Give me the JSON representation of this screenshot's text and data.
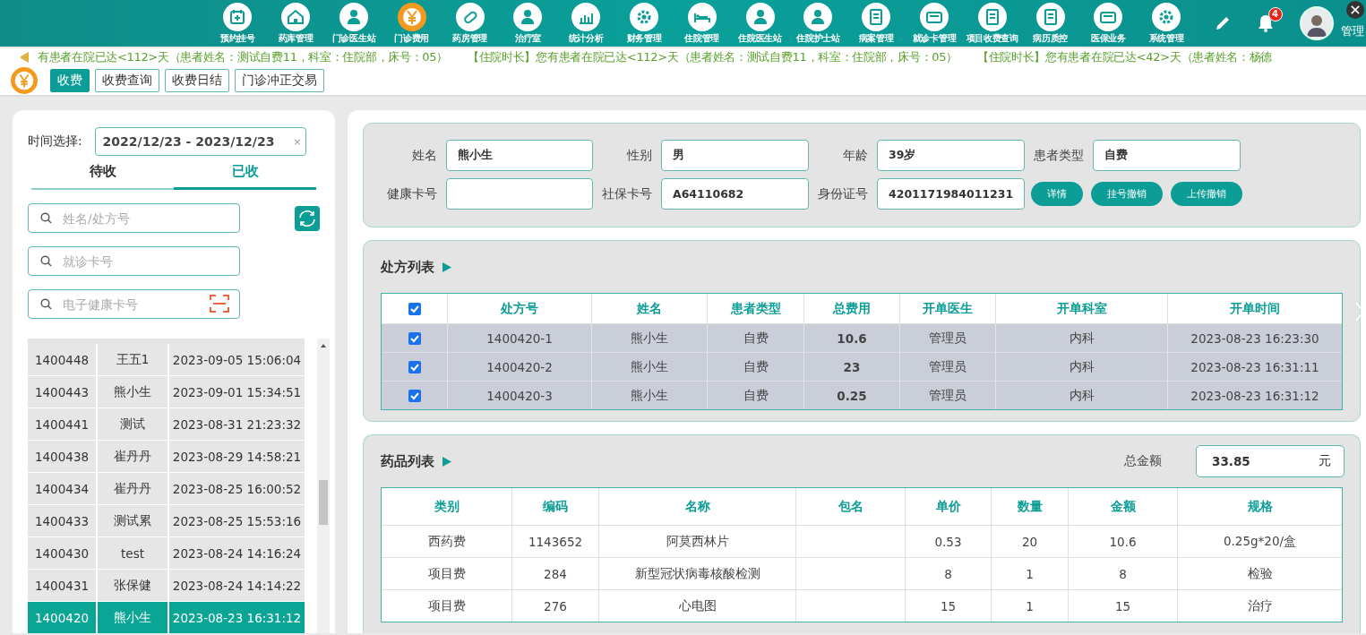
{
  "nav": {
    "items": [
      {
        "label": "预约挂号",
        "selected": false
      },
      {
        "label": "药库管理",
        "selected": false
      },
      {
        "label": "门诊医生站",
        "selected": false
      },
      {
        "label": "门诊费用",
        "selected": true
      },
      {
        "label": "药房管理",
        "selected": false
      },
      {
        "label": "治疗室",
        "selected": false
      },
      {
        "label": "统计分析",
        "selected": false
      },
      {
        "label": "财务管理",
        "selected": false
      },
      {
        "label": "住院管理",
        "selected": false
      },
      {
        "label": "住院医生站",
        "selected": false
      },
      {
        "label": "住院护士站",
        "selected": false
      },
      {
        "label": "病案管理",
        "selected": false
      },
      {
        "label": "就诊卡管理",
        "selected": false
      },
      {
        "label": "项目收费查询",
        "selected": false
      },
      {
        "label": "病历质控",
        "selected": false
      },
      {
        "label": "医保业务",
        "selected": false
      },
      {
        "label": "系统管理",
        "selected": false
      }
    ],
    "notification_count": "4",
    "user_name": "管理"
  },
  "notices": [
    "有患者在院已达<112>天（患者姓名：测试自费11，科室：住院部，床号：05）",
    "【住院时长】您有患者在院已达<112>天（患者姓名：测试自费11，科室：住院部，床号：05）",
    "【住院时长】您有患者在院已达<42>天（患者姓名：杨德"
  ],
  "sub_tabs": [
    {
      "label": "收费",
      "selected": true
    },
    {
      "label": "收费查询",
      "selected": false
    },
    {
      "label": "收费日结",
      "selected": false
    },
    {
      "label": "门诊冲正交易",
      "selected": false
    }
  ],
  "filter": {
    "label": "时间选择:",
    "date_range": "2022/12/23 - 2023/12/23",
    "clear": "×"
  },
  "status_tabs": [
    {
      "label": "待收",
      "selected": false
    },
    {
      "label": "已收",
      "selected": true
    }
  ],
  "search_fields": [
    {
      "placeholder": "姓名/处方号",
      "kind": "text"
    },
    {
      "placeholder": "就诊卡号",
      "kind": "text"
    },
    {
      "placeholder": "电子健康卡号",
      "kind": "scan"
    }
  ],
  "records": [
    {
      "id": "1400448",
      "name": "王五1",
      "time": "2023-09-05 15:06:04",
      "selected": false
    },
    {
      "id": "1400443",
      "name": "熊小生",
      "time": "2023-09-01 15:34:51",
      "selected": false
    },
    {
      "id": "1400441",
      "name": "测试",
      "time": "2023-08-31 21:23:32",
      "selected": false
    },
    {
      "id": "1400438",
      "name": "崔丹丹",
      "time": "2023-08-29 14:58:21",
      "selected": false
    },
    {
      "id": "1400434",
      "name": "崔丹丹",
      "time": "2023-08-25 16:00:52",
      "selected": false
    },
    {
      "id": "1400433",
      "name": "测试累",
      "time": "2023-08-25 15:53:16",
      "selected": false
    },
    {
      "id": "1400430",
      "name": "test",
      "time": "2023-08-24 14:16:24",
      "selected": false
    },
    {
      "id": "1400431",
      "name": "张保健",
      "time": "2023-08-24 14:14:22",
      "selected": false
    },
    {
      "id": "1400420",
      "name": "熊小生",
      "time": "2023-08-23 16:31:12",
      "selected": true
    }
  ],
  "patient": {
    "fields": [
      {
        "label": "姓名",
        "value": "熊小生"
      },
      {
        "label": "性别",
        "value": "男"
      },
      {
        "label": "年龄",
        "value": "39岁"
      },
      {
        "label": "患者类型",
        "value": "自费"
      },
      {
        "label": "健康卡号"
      },
      {
        "label": "社保卡号",
        "value": "A64110682"
      },
      {
        "label": "身份证号",
        "value": "4201171984011231"
      }
    ],
    "buttons": [
      "详情",
      "挂号撤销",
      "上传撤销"
    ]
  },
  "prescriptions": {
    "title": "处方列表",
    "all_checked": true,
    "columns": [
      "处方号",
      "姓名",
      "患者类型",
      "总费用",
      "开单医生",
      "开单科室",
      "开单时间"
    ],
    "rows": [
      {
        "checked": true,
        "cells": [
          "1400420-1",
          "熊小生",
          "自费",
          "10.6",
          "管理员",
          "内科",
          "2023-08-23 16:23:30"
        ]
      },
      {
        "checked": true,
        "cells": [
          "1400420-2",
          "熊小生",
          "自费",
          "23",
          "管理员",
          "内科",
          "2023-08-23 16:31:11"
        ]
      },
      {
        "checked": true,
        "cells": [
          "1400420-3",
          "熊小生",
          "自费",
          "0.25",
          "管理员",
          "内科",
          "2023-08-23 16:31:12"
        ]
      }
    ]
  },
  "drugs": {
    "title": "药品列表",
    "total_label": "总金额",
    "total": "33.85",
    "unit": "元",
    "columns": [
      "类别",
      "编码",
      "名称",
      "包名",
      "单价",
      "数量",
      "金额",
      "规格"
    ],
    "rows": [
      [
        "西药费",
        "1143652",
        "阿莫西林片",
        "",
        "0.53",
        "20",
        "10.6",
        "0.25g*20/盒"
      ],
      [
        "项目费",
        "284",
        "新型冠状病毒核酸检测",
        "",
        "8",
        "1",
        "8",
        "检验"
      ],
      [
        "项目费",
        "276",
        "心电图",
        "",
        "15",
        "1",
        "15",
        "治疗"
      ]
    ]
  }
}
